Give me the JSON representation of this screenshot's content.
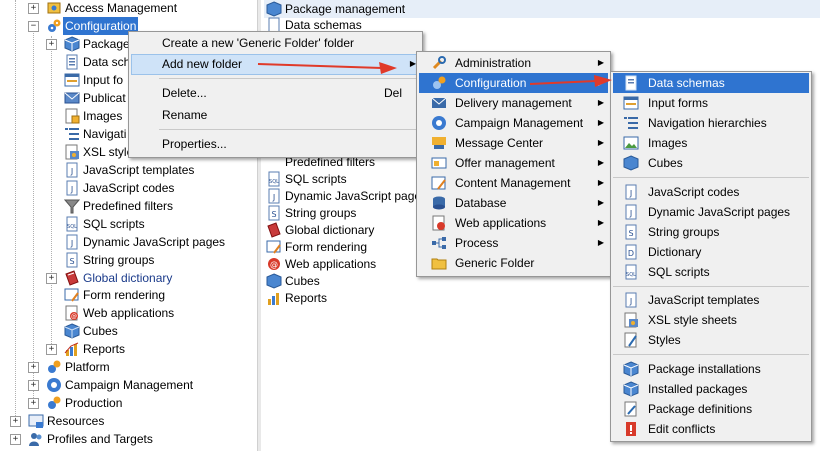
{
  "tree": {
    "items": [
      {
        "label": "Access Management",
        "icon": "access-management-icon"
      },
      {
        "label": "Configuration",
        "icon": "configuration-gears-icon"
      },
      {
        "label": "Packages",
        "icon": "package-icon"
      },
      {
        "label": "Data schemas",
        "icon": "data-schema-icon"
      },
      {
        "label": "Input forms",
        "icon": "input-form-icon"
      },
      {
        "label": "Publications",
        "icon": "publication-icon"
      },
      {
        "label": "Images",
        "icon": "image-icon"
      },
      {
        "label": "Navigation hierarchies",
        "icon": "navigation-icon"
      },
      {
        "label": "XSL style sheets",
        "icon": "xsl-icon"
      },
      {
        "label": "JavaScript templates",
        "icon": "js-template-icon"
      },
      {
        "label": "JavaScript codes",
        "icon": "js-code-icon"
      },
      {
        "label": "Predefined filters",
        "icon": "filter-icon"
      },
      {
        "label": "SQL scripts",
        "icon": "sql-icon"
      },
      {
        "label": "Dynamic JavaScript pages",
        "icon": "js-page-icon"
      },
      {
        "label": "String groups",
        "icon": "string-group-icon"
      },
      {
        "label": "Global dictionary",
        "icon": "dictionary-icon"
      },
      {
        "label": "Form rendering",
        "icon": "form-rendering-icon"
      },
      {
        "label": "Web applications",
        "icon": "web-app-icon"
      },
      {
        "label": "Cubes",
        "icon": "cube-icon"
      },
      {
        "label": "Reports",
        "icon": "report-icon"
      },
      {
        "label": "Platform",
        "icon": "platform-icon"
      },
      {
        "label": "Campaign Management",
        "icon": "campaign-icon"
      },
      {
        "label": "Production",
        "icon": "production-icon"
      },
      {
        "label": "Resources",
        "icon": "resources-icon"
      },
      {
        "label": "Profiles and Targets",
        "icon": "profiles-icon"
      }
    ],
    "truncated": {
      "packages": "Package",
      "data_schemas": "Data sch",
      "input_forms": "Input fo",
      "publications": "Publicat",
      "images": "Images",
      "navigation": "Navigati",
      "xsl": "XSL style"
    }
  },
  "list": {
    "items": [
      "Package management",
      "Data schemas",
      "Predefined filters",
      "SQL scripts",
      "Dynamic JavaScript pages",
      "String groups",
      "Global dictionary",
      "Form rendering",
      "Web applications",
      "Cubes",
      "Reports"
    ]
  },
  "context_menu": {
    "create_folder": "Create a new 'Generic Folder' folder",
    "add_new_folder": "Add new folder",
    "delete": "Delete...",
    "delete_shortcut": "Del",
    "rename": "Rename",
    "properties": "Properties..."
  },
  "submenu1": {
    "items": [
      "Administration",
      "Configuration",
      "Delivery management",
      "Campaign Management",
      "Message Center",
      "Offer management",
      "Content Management",
      "Database",
      "Web applications",
      "Process",
      "Generic Folder"
    ]
  },
  "submenu2": {
    "groups": [
      [
        "Data schemas",
        "Input forms",
        "Navigation hierarchies",
        "Images",
        "Cubes"
      ],
      [
        "JavaScript codes",
        "Dynamic JavaScript pages",
        "String groups",
        "Dictionary",
        "SQL scripts"
      ],
      [
        "JavaScript templates",
        "XSL style sheets",
        "Styles"
      ],
      [
        "Package installations",
        "Installed packages",
        "Package definitions",
        "Edit conflicts"
      ]
    ]
  },
  "colors": {
    "highlight": "#2f74d0",
    "arrow": "#e03a2a"
  }
}
